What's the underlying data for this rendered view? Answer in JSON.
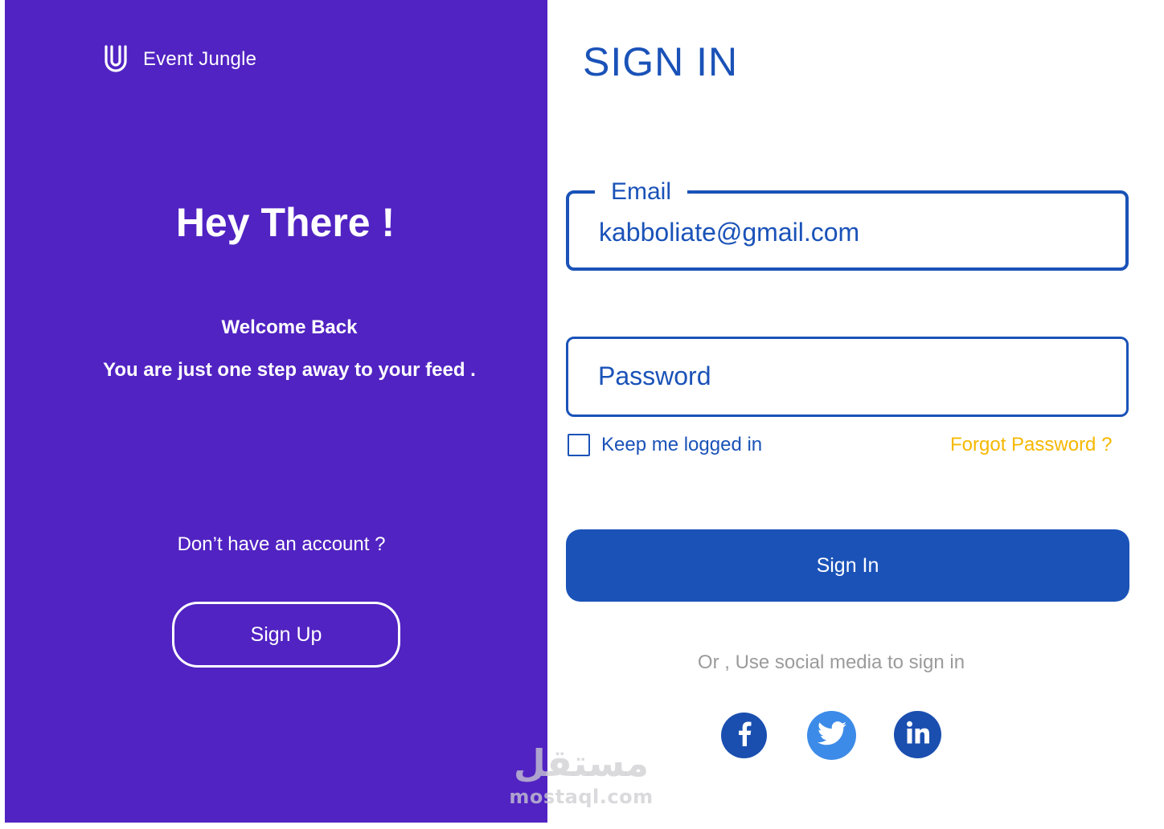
{
  "brand": {
    "name": "Event Jungle",
    "logo_icon": "u-logo-icon"
  },
  "left_panel": {
    "heading": "Hey There !",
    "welcome": "Welcome Back",
    "tagline": "You are just one step away to your feed .",
    "no_account_text": "Don’t have an account ?",
    "signup_label": "Sign Up",
    "background_color": "#5123c2"
  },
  "form": {
    "title": "SIGN IN",
    "email": {
      "label": "Email",
      "value": "kabboliate@gmail.com"
    },
    "password": {
      "placeholder": "Password"
    },
    "remember_label": "Keep me logged in",
    "remember_checked": false,
    "forgot_label": "Forgot Password ?",
    "submit_label": "Sign In",
    "accent_color": "#1a52b8",
    "forgot_color": "#f5b800"
  },
  "social": {
    "prompt": "Or , Use social media to sign in",
    "providers": [
      {
        "name": "facebook",
        "icon": "facebook-icon",
        "color": "#1a4fb0"
      },
      {
        "name": "twitter",
        "icon": "twitter-icon",
        "color": "#3d8be8"
      },
      {
        "name": "linkedin",
        "icon": "linkedin-icon",
        "color": "#1a4fb0"
      }
    ]
  },
  "watermark": {
    "arabic": "مستقل",
    "latin": "mostaql.com"
  }
}
